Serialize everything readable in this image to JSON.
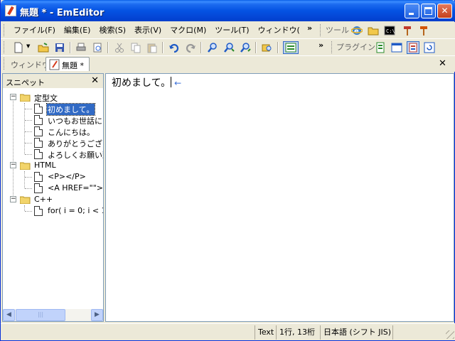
{
  "window": {
    "title": "無題 * - EmEditor"
  },
  "menu": {
    "items": [
      "ファイル(F)",
      "編集(E)",
      "検索(S)",
      "表示(V)",
      "マクロ(M)",
      "ツール(T)",
      "ウィンドウ("
    ],
    "tools_label": "ツール",
    "plugins_label": "プラグイン"
  },
  "tabbar": {
    "label": "ウィンドウ",
    "tab_title": "無題 *"
  },
  "snippets": {
    "title": "スニペット",
    "folders": [
      {
        "name": "定型文",
        "items": [
          "初めまして。",
          "いつもお世話にな",
          "こんにちは。",
          "ありがとうございま",
          "よろしくお願い致"
        ]
      },
      {
        "name": "HTML",
        "items": [
          "<P></P>",
          "<A HREF=\"\">"
        ]
      },
      {
        "name": "C++",
        "items": [
          "for( i = 0; i < 1"
        ]
      }
    ]
  },
  "editor": {
    "text": "初めまして。",
    "eol_mark": "←"
  },
  "status": {
    "mode": "Text",
    "position": "1行, 13桁",
    "encoding": "日本語 (シフト JIS)"
  },
  "colors": {
    "title_bar": "#0453e3",
    "selection": "#316ac5",
    "eol_mark": "#3a6fd8"
  }
}
